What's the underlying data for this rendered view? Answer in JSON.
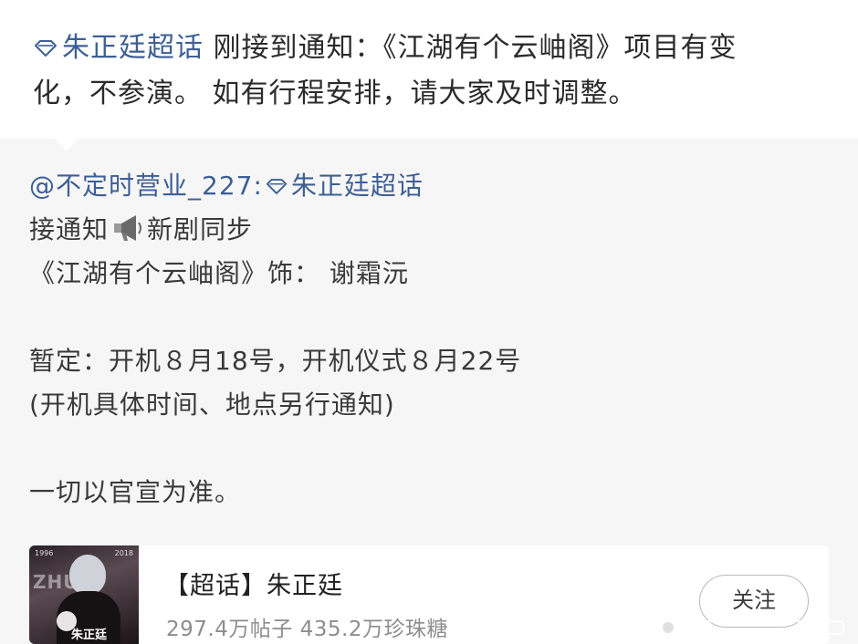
{
  "main_post": {
    "topic": "朱正廷超话",
    "text": " 刚接到通知：《江湖有个云岫阁》项目有变",
    "text_line2": "化，不参演。 如有行程安排，请大家及时调整。"
  },
  "repost": {
    "author": "@不定时营业_227:",
    "topic": "朱正廷超话",
    "line2_before": "接通知",
    "line2_after": "新剧同步",
    "line3": "《江湖有个云岫阁》饰：  谢霜沅",
    "line5": "暂定：开机８月18号，开机仪式８月22号",
    "line6": "(开机具体时间、地点另行通知)",
    "line8": "一切以官宣为准。"
  },
  "topic_card": {
    "title": "【超话】朱正廷",
    "stats": "297.4万帖子 435.2万珍珠糖",
    "follow_label": "关注",
    "cover": {
      "year_left": "1996",
      "year_right": "2018",
      "letters": "ZHU",
      "name": "朱正廷"
    }
  },
  "icons": {
    "topic": "diamond-icon",
    "megaphone": "megaphone-icon",
    "watermark": "weibo-watermark-icon"
  },
  "colors": {
    "link": "#3d5f95",
    "repost_bg": "#f6f6f6",
    "stats_gray": "#8d8d8d"
  }
}
